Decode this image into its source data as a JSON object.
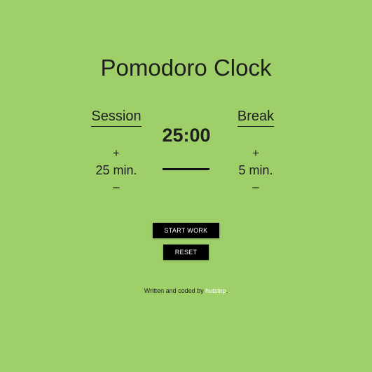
{
  "title": "Pomodoro Clock",
  "session": {
    "label": "Session",
    "plus": "+",
    "length": "25 min.",
    "minus": "–"
  },
  "break": {
    "label": "Break",
    "plus": "+",
    "length": "5 min.",
    "minus": "–"
  },
  "timer": {
    "display": "25:00"
  },
  "buttons": {
    "start": "START WORK",
    "reset": "RESET"
  },
  "footer": {
    "text": "Written and coded by ",
    "author": "hutstep",
    "suffix": "."
  },
  "colors": {
    "background": "#9ecf69",
    "text": "#1e1e1e",
    "button_bg": "#000000",
    "button_text": "#ffffff",
    "link": "#ffffff"
  }
}
